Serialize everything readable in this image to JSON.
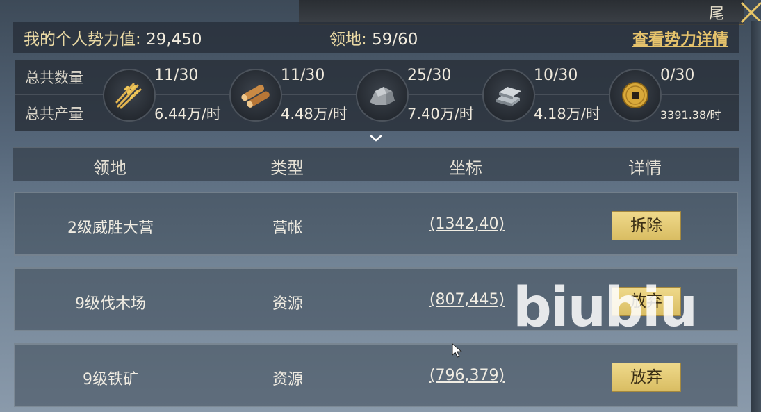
{
  "top": {
    "char": "尾",
    "sword_icon": "crossed-swords-icon"
  },
  "header": {
    "power_label": "我的个人势力值:",
    "power_value": "29,450",
    "land_label": "领地:",
    "land_value": "59/60",
    "detail_link": "查看势力详情"
  },
  "resources": {
    "total_count_label": "总共数量",
    "total_output_label": "总共产量",
    "items": [
      {
        "icon": "wheat-icon",
        "count": "11/30",
        "rate": "6.44万/时"
      },
      {
        "icon": "wood-log-icon",
        "count": "11/30",
        "rate": "4.48万/时"
      },
      {
        "icon": "stone-icon",
        "count": "25/30",
        "rate": "7.40万/时"
      },
      {
        "icon": "iron-ingot-icon",
        "count": "10/30",
        "rate": "4.18万/时"
      },
      {
        "icon": "copper-coin-icon",
        "count": "0/30",
        "rate": "3391.38/时"
      }
    ]
  },
  "table": {
    "headers": [
      "领地",
      "类型",
      "坐标",
      "详情"
    ],
    "rows": [
      {
        "name": "2级威胜大营",
        "type": "营帐",
        "coord": "(1342,40)",
        "action": "拆除"
      },
      {
        "name": "9级伐木场",
        "type": "资源",
        "coord": "(807,445)",
        "action": "放弃"
      },
      {
        "name": "9级铁矿",
        "type": "资源",
        "coord": "(796,379)",
        "action": "放弃"
      }
    ]
  },
  "watermark": "biubiu",
  "colors": {
    "accent_gold": "#e6c36c",
    "button_gold": "#e3c873",
    "panel_dark": "#262d36"
  }
}
